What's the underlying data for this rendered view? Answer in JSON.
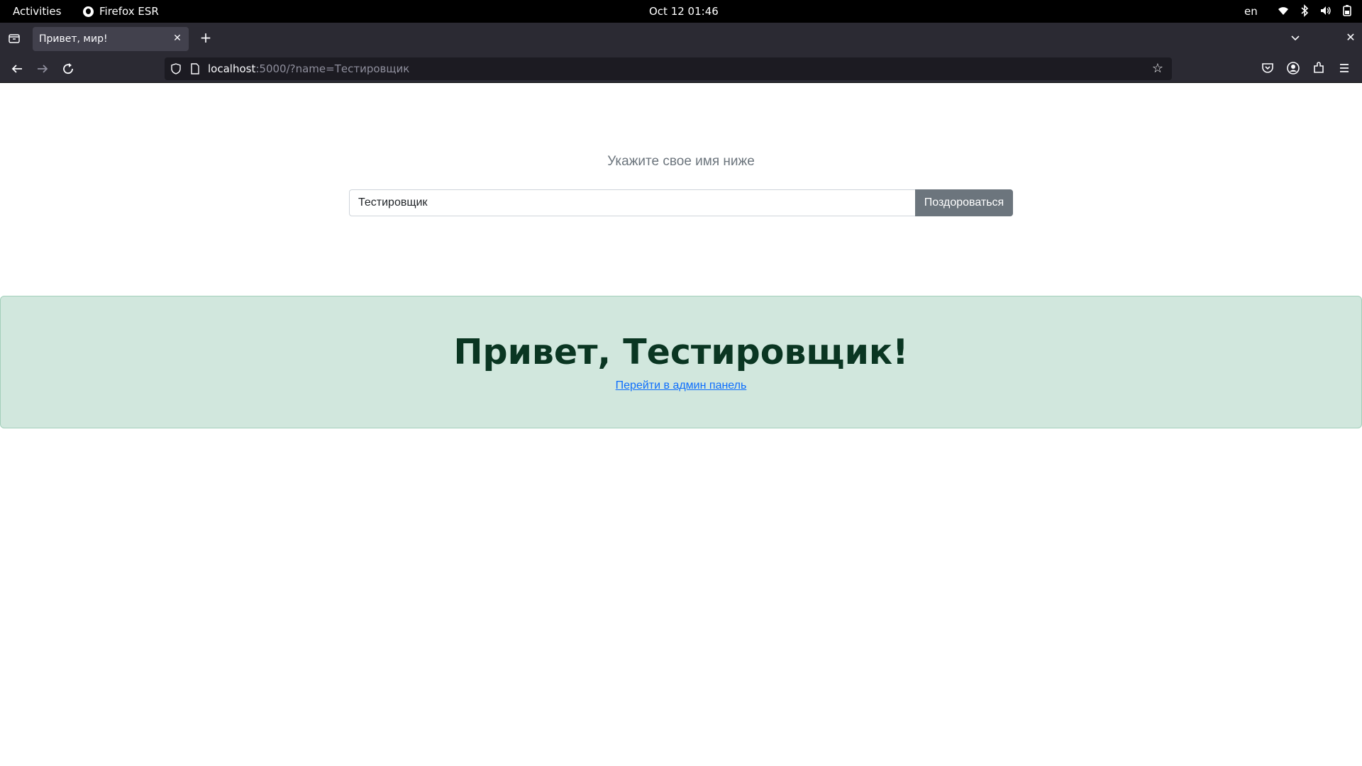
{
  "system": {
    "activities": "Activities",
    "app_name": "Firefox ESR",
    "clock": "Oct 12  01:46",
    "lang": "en"
  },
  "browser": {
    "tab_title": "Привет, мир!",
    "url_host": "localhost",
    "url_rest": ":5000/?name=Тестировщик"
  },
  "page": {
    "prompt": "Укажите свое имя ниже",
    "name_value": "Тестировщик",
    "submit_label": "Поздороваться",
    "greeting": "Привет, Тестировщик!",
    "admin_link": "Перейти в админ панель"
  }
}
